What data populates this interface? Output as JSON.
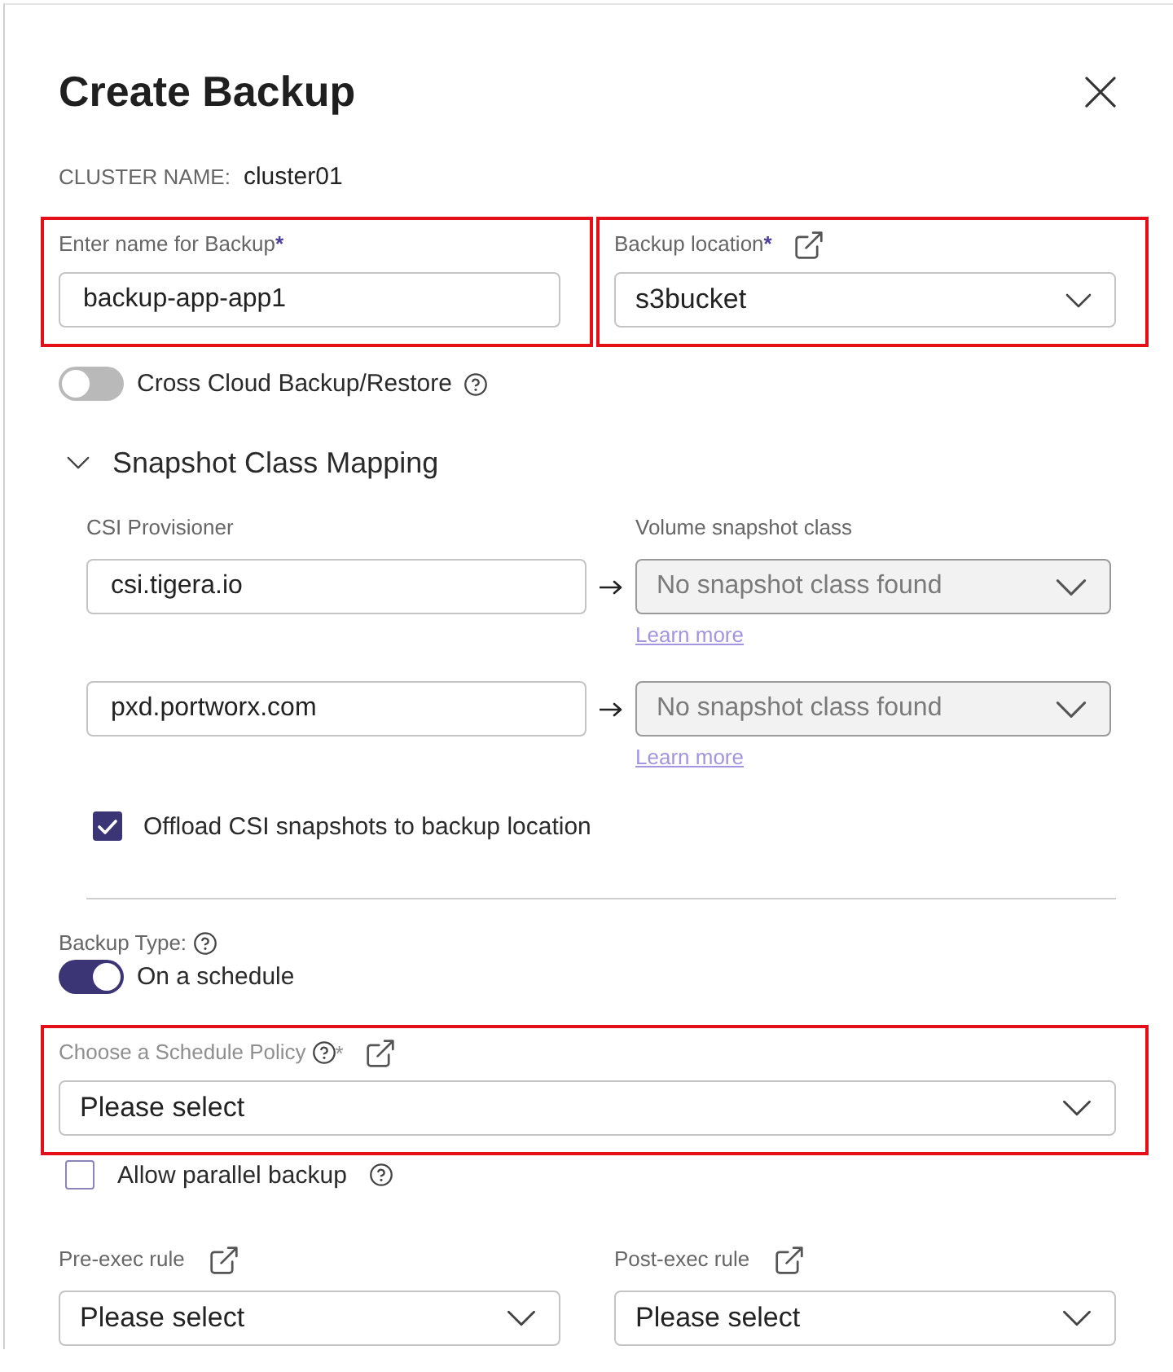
{
  "dialog": {
    "title": "Create Backup"
  },
  "cluster": {
    "label": "CLUSTER NAME:",
    "value": "cluster01"
  },
  "backup_name": {
    "label": "Enter name for Backup",
    "required_mark": "*",
    "value": "backup-app-app1",
    "highlighted": true
  },
  "backup_location": {
    "label": "Backup location",
    "required_mark": "*",
    "value": "s3bucket",
    "highlighted": true
  },
  "cross_cloud": {
    "label": "Cross Cloud Backup/Restore",
    "on": false
  },
  "snapshot_mapping": {
    "title": "Snapshot Class Mapping",
    "expanded": true,
    "columns": [
      "CSI Provisioner",
      "Volume snapshot class"
    ],
    "rows": [
      {
        "provisioner": "csi.tigera.io",
        "snapshot_class": "No snapshot class found",
        "disabled": true,
        "link": "Learn more"
      },
      {
        "provisioner": "pxd.portworx.com",
        "snapshot_class": "No snapshot class found",
        "disabled": true,
        "link": "Learn more"
      }
    ],
    "offload": {
      "label": "Offload CSI snapshots to backup location",
      "checked": true
    }
  },
  "backup_type": {
    "label": "Backup Type:",
    "toggle_label": "On a schedule",
    "on": true
  },
  "schedule_policy": {
    "label": "Choose a Schedule Policy",
    "required_mark": "*",
    "placeholder": "Please select",
    "highlighted": true
  },
  "parallel_backup": {
    "label": "Allow parallel backup",
    "checked": false
  },
  "rules": [
    {
      "label": "Pre-exec rule",
      "placeholder": "Please select"
    },
    {
      "label": "Post-exec rule",
      "placeholder": "Please select"
    }
  ]
}
